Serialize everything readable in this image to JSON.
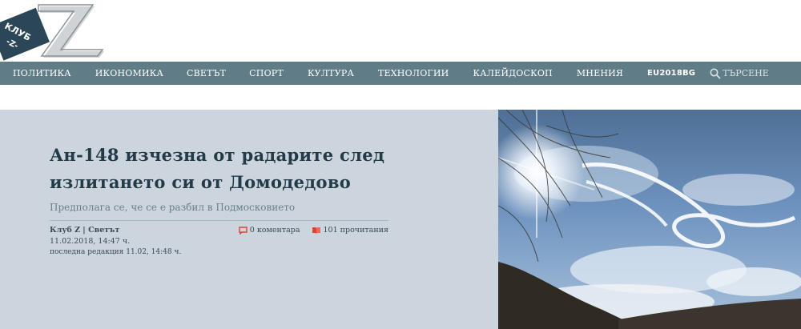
{
  "logo": {
    "text": "КЛУБ",
    "sub": "-Z-",
    "letter": "Z"
  },
  "nav": {
    "items": [
      "ПОЛИТИКА",
      "ИКОНОМИКА",
      "СВЕТЪТ",
      "СПОРТ",
      "КУЛТУРА",
      "ТЕХНОЛОГИИ",
      "КАЛЕЙДОСКОП",
      "МНЕНИЯ",
      "EU2018BG"
    ],
    "search_label": "ТЪРСЕНЕ"
  },
  "article": {
    "title": "Ан-148 изчезна от радарите след излитането си от Домодедово",
    "subtitle": "Предполага се, че се е разбил в Подмосковието",
    "author": "Клуб Z | Светът",
    "date": "11.02.2018, 14:47 ч.",
    "last_edit": "последна редакция 11.02, 14:48 ч.",
    "comments": "0 коментара",
    "reads": "101 прочитания"
  },
  "colors": {
    "nav_bg": "#5f7c87",
    "hero_bg": "#ccd5dd",
    "title": "#233a48",
    "accent_red": "#d9472b"
  }
}
